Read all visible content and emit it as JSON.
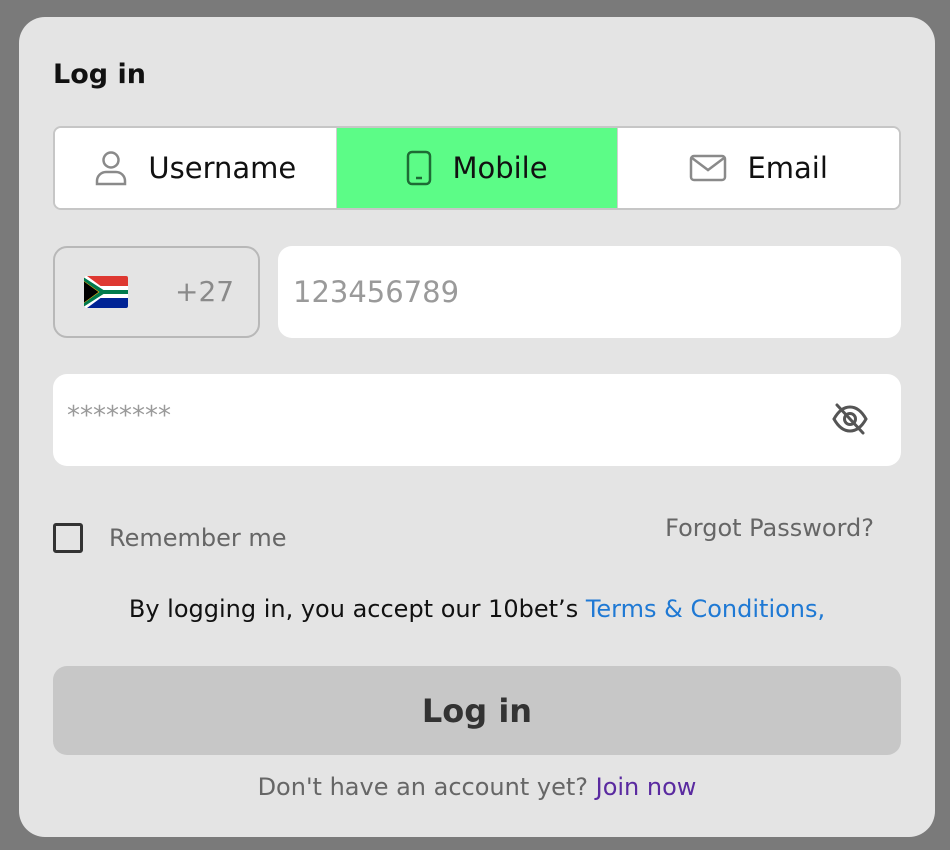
{
  "modal": {
    "title": "Log in"
  },
  "tabs": [
    {
      "label": "Username",
      "icon": "user-icon",
      "active": false
    },
    {
      "label": "Mobile",
      "icon": "mobile-phone-icon",
      "active": true
    },
    {
      "label": "Email",
      "icon": "envelope-icon",
      "active": false
    }
  ],
  "colors": {
    "active_tab": "#5cfc87",
    "link": "#1f79d4",
    "join_link": "#5a2aa0"
  },
  "country": {
    "code": "+27",
    "flag_icon": "south-africa-flag-icon"
  },
  "phone": {
    "placeholder": "123456789"
  },
  "password": {
    "placeholder": "********",
    "toggle_icon": "eye-slash-icon"
  },
  "remember": {
    "label": "Remember me"
  },
  "forgot": {
    "label": "Forgot Password?"
  },
  "terms": {
    "prefix": "By logging in, you accept our 10bet’s ",
    "link": "Terms & Conditions,"
  },
  "login_button": {
    "label": "Log in"
  },
  "signup": {
    "prompt": "Don't have an account yet? ",
    "link": "Join now"
  }
}
